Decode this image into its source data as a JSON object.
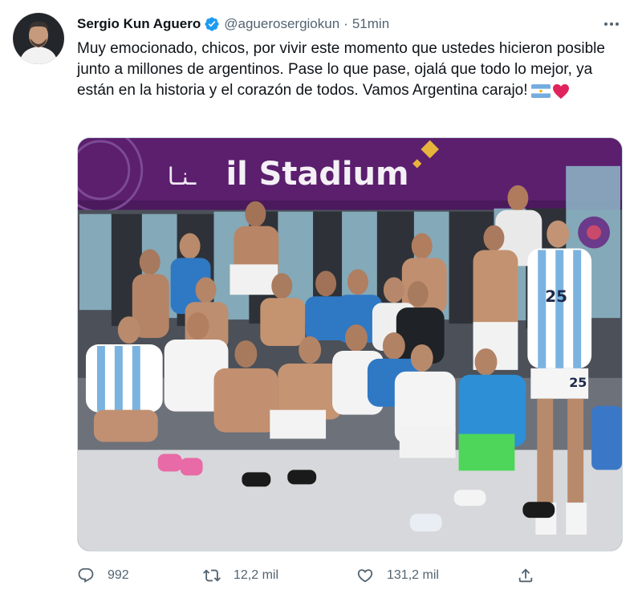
{
  "author": {
    "name": "Sergio Kun Aguero",
    "handle": "@aguerosergiokun",
    "separator": "·",
    "time": "51min",
    "verified": true
  },
  "tweet": {
    "text": "Muy emocionado, chicos, por vivir este momento que ustedes hicieron posible junto a millones de argentinos. Pase lo que pase, ojalá que todo lo mejor, ya están en la historia y el corazón de todos. Vamos Argentina carajo!",
    "emoji": [
      "argentina-flag",
      "red-heart"
    ]
  },
  "media": {
    "sign_text": "il Stadium",
    "sign_prefix": "ـنـا",
    "jersey_numbers": [
      "25",
      "25"
    ]
  },
  "actions": {
    "reply_count": "992",
    "retweet_count": "12,2 mil",
    "like_count": "131,2 mil"
  },
  "colors": {
    "verified": "#1d9bf0",
    "secondary_text": "#536471",
    "banner": "#5b1f6e",
    "heart": "#e0245e"
  }
}
